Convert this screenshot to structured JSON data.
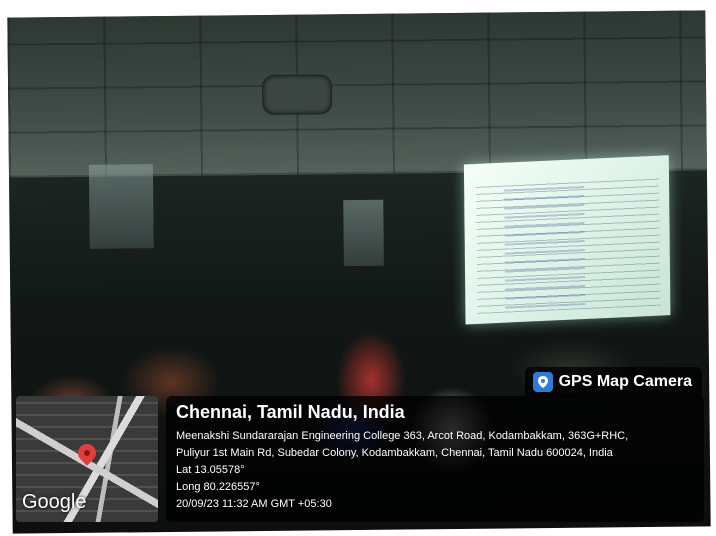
{
  "overlay": {
    "app_name": "GPS Map Camera",
    "city": "Chennai, Tamil Nadu, India",
    "address_line1": "Meenakshi Sundararajan Engineering College 363, Arcot Road, Kodambakkam, 363G+RHC,",
    "address_line2": "Puliyur 1st Main Rd, Subedar Colony, Kodambakkam, Chennai, Tamil Nadu 600024, India",
    "lat": "Lat 13.05578°",
    "long": "Long 80.226557°",
    "timestamp": "20/09/23 11:32 AM GMT +05:30",
    "map_brand": "Google"
  },
  "colors": {
    "pin": "#e43d3d",
    "logo": "#2f7bd8"
  }
}
